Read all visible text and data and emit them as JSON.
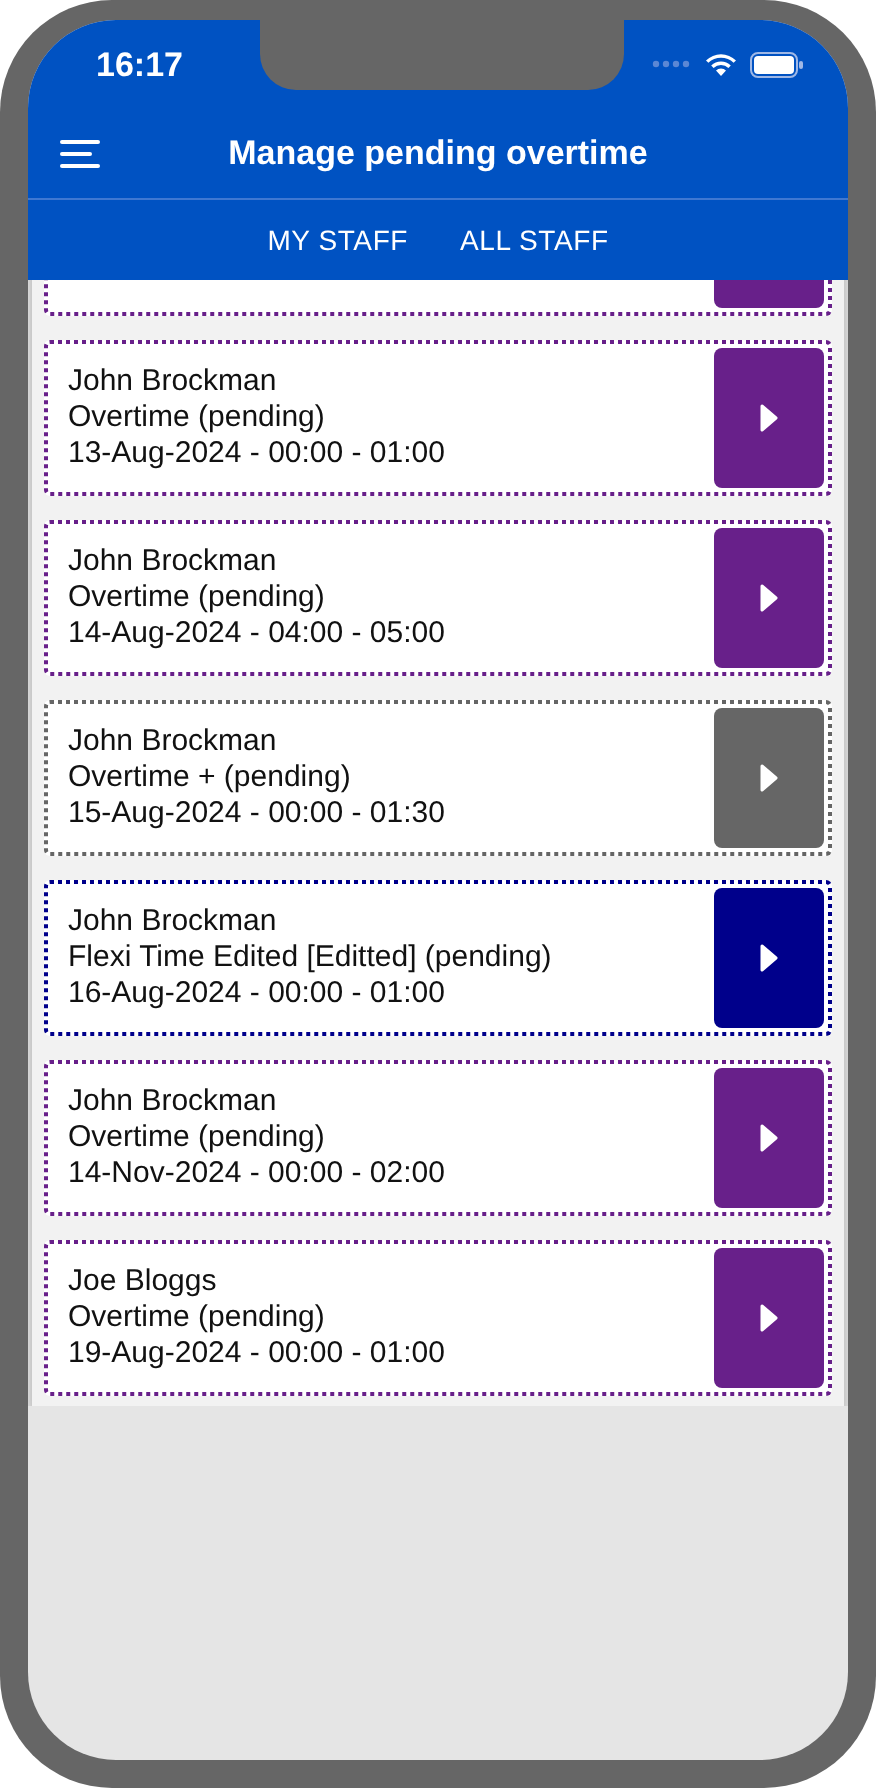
{
  "status_bar": {
    "time": "16:17"
  },
  "header": {
    "title": "Manage pending overtime"
  },
  "tabs": [
    {
      "label": "MY STAFF"
    },
    {
      "label": "ALL STAFF"
    }
  ],
  "partial_card": {
    "color": "#68208a"
  },
  "requests": [
    {
      "name": "John Brockman",
      "type": "Overtime (pending)",
      "when": "13-Aug-2024 - 00:00 - 01:00",
      "color": "#68208a"
    },
    {
      "name": "John Brockman",
      "type": "Overtime (pending)",
      "when": "14-Aug-2024 - 04:00 - 05:00",
      "color": "#68208a"
    },
    {
      "name": "John Brockman",
      "type": "Overtime + (pending)",
      "when": "15-Aug-2024 - 00:00 - 01:30",
      "color": "#666666"
    },
    {
      "name": "John Brockman",
      "type": "Flexi Time Edited [Editted] (pending)",
      "when": "16-Aug-2024 - 00:00 - 01:00",
      "color": "#00008b"
    },
    {
      "name": "John Brockman",
      "type": "Overtime (pending)",
      "when": "14-Nov-2024 - 00:00 - 02:00",
      "color": "#68208a"
    },
    {
      "name": "Joe Bloggs",
      "type": "Overtime (pending)",
      "when": "19-Aug-2024 - 00:00 - 01:00",
      "color": "#68208a"
    }
  ]
}
